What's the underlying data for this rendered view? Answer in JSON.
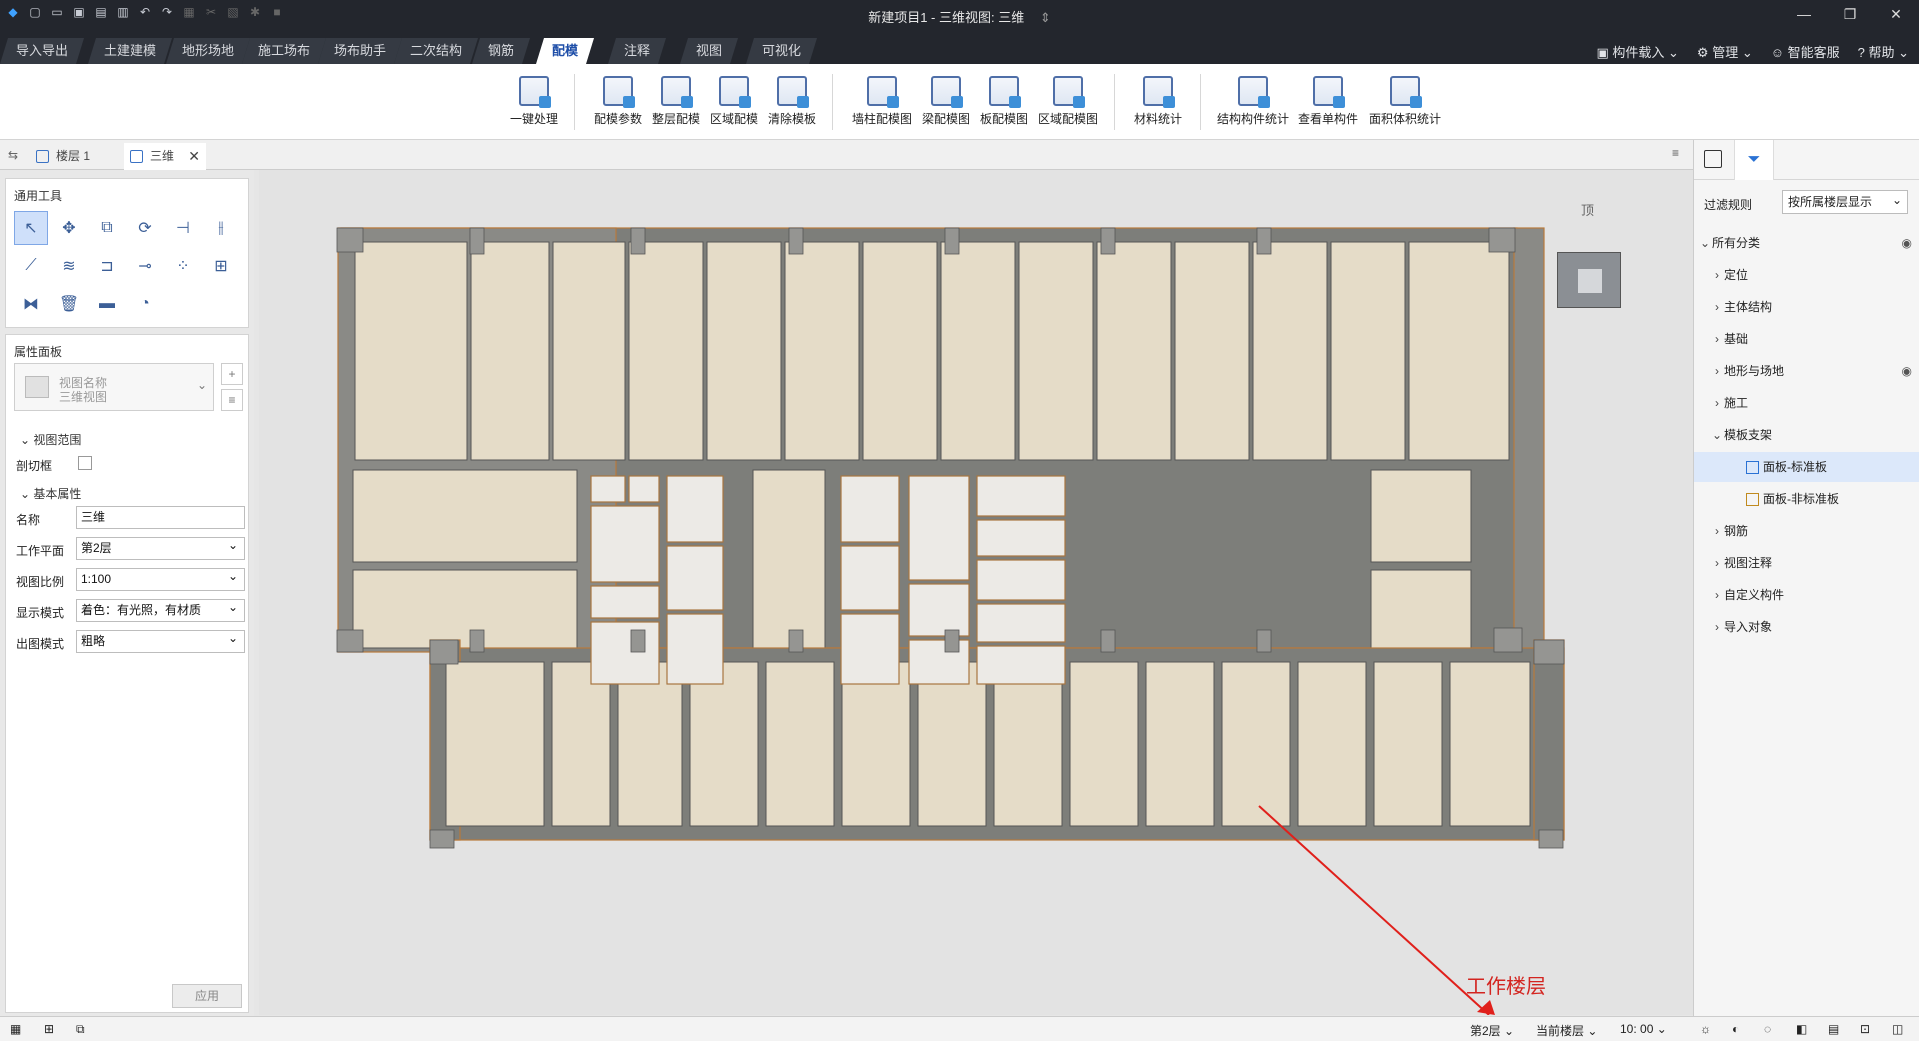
{
  "title": "新建项目1 - 三维视图: 三维",
  "title_suffix": "⇕",
  "tabs": [
    "导入导出",
    "土建建模",
    "地形场地",
    "施工场布",
    "场布助手",
    "二次结构",
    "钢筋",
    "配模",
    "注释",
    "视图",
    "可视化"
  ],
  "right_menu": [
    "构件载入",
    "管理",
    "智能客服",
    "帮助"
  ],
  "ribbon": [
    "一键处理",
    "配模参数",
    "整层配模",
    "区域配模",
    "清除模板",
    "墙柱配模图",
    "梁配模图",
    "板配模图",
    "区域配模图",
    "材料统计",
    "结构构件统计",
    "查看单构件",
    "面积体积统计"
  ],
  "doc_tabs": [
    "楼层 1",
    "三维"
  ],
  "tools_title": "通用工具",
  "props": {
    "title": "属性面板",
    "view_name_label": "视图名称",
    "view_name_value": "三维视图",
    "section_range": "视图范围",
    "cut_box": "剖切框",
    "section_basic": "基本属性",
    "rows": [
      {
        "label": "名称",
        "value": "三维"
      },
      {
        "label": "工作平面",
        "value": "第2层"
      },
      {
        "label": "视图比例",
        "value": "1:100"
      },
      {
        "label": "显示模式",
        "value": "着色：有光照，有材质"
      },
      {
        "label": "出图模式",
        "value": "粗略"
      }
    ],
    "apply": "应用"
  },
  "viewcube_label": "顶",
  "annotation": "工作楼层",
  "filter": {
    "label": "过滤规则",
    "value": "按所属楼层显示"
  },
  "tree": [
    "所有分类",
    "定位",
    "主体结构",
    "基础",
    "地形与场地",
    "施工",
    "模板支架",
    "面板-标准板",
    "面板-非标准板",
    "钢筋",
    "视图注释",
    "自定义构件",
    "导入对象"
  ],
  "status": {
    "floor": "第2层",
    "scope": "当前楼层",
    "time": "10: 00"
  }
}
